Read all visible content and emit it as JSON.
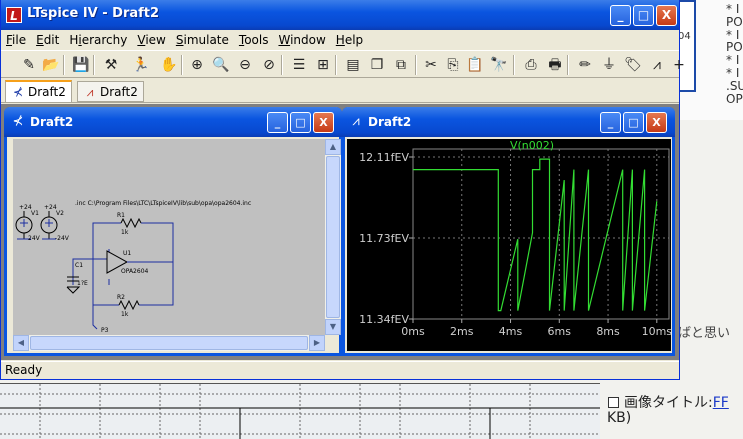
{
  "window": {
    "title": "LTspice IV - Draft2",
    "buttons": {
      "minimize": "_",
      "maximize": "□",
      "close": "X"
    }
  },
  "menu": [
    "File",
    "Edit",
    "Hierarchy",
    "View",
    "Simulate",
    "Tools",
    "Window",
    "Help"
  ],
  "menu_underline": [
    "F",
    "E",
    "i",
    "V",
    "S",
    "T",
    "W",
    "H"
  ],
  "toolbar_icons": [
    "new-schematic-icon",
    "open-icon",
    "save-icon",
    "hammer-icon",
    "run-icon",
    "halt-icon",
    "zoom-in-icon",
    "zoom-area-icon",
    "zoom-out-icon",
    "zoom-cancel-icon",
    "autorange-icon",
    "fit-icon",
    "tile-icon",
    "cascade-icon",
    "arrange-icon",
    "cut-icon",
    "copy-icon",
    "paste-icon",
    "find-icon",
    "print-setup-icon",
    "print-icon",
    "pencil-icon",
    "ground-icon",
    "label-icon",
    "resistor-icon",
    "plus-icon"
  ],
  "tabs": [
    {
      "label": "Draft2",
      "icon": "schematic-icon",
      "active": true
    },
    {
      "label": "Draft2",
      "icon": "waveform-icon",
      "active": false
    }
  ],
  "schematic_window": {
    "title": "Draft2",
    "inc_text": ".inc C:\\Program Files\\LTC\\LTspiceIV\\lib\\sub\\opa\\opa2604.inc",
    "labels": {
      "v1": "V1",
      "v2": "V2",
      "v1_val": "24V",
      "v2_val": "-24V",
      "v1_top": "+24",
      "v2_top": "+24",
      "r1": "R1",
      "r1_val": "1k",
      "r2": "R2",
      "r2_val": "1k",
      "c1": "C1",
      "c1_val": "1?E",
      "u1": "U1",
      "opamp": "OPA2604",
      "p3": "P3"
    }
  },
  "waveform_window": {
    "title": "Draft2",
    "trace_label": "V(n002)",
    "y_ticks": [
      "12.11fEV",
      "11.73fEV",
      "11.34fEV"
    ],
    "x_ticks": [
      "0ms",
      "2ms",
      "4ms",
      "6ms",
      "8ms",
      "10ms"
    ],
    "trace_color": "#33dd33"
  },
  "status": "Ready",
  "background": {
    "code_lines": [
      "* I",
      "PO",
      "* I",
      "PO",
      "* I",
      "* I",
      ".SU",
      "OP"
    ],
    "code_side": "04",
    "jp_note": "ばと思い",
    "checkbox_label": "画像タイトル:",
    "checkbox_link": "FF",
    "kb_text": "KB)"
  },
  "chart_data": {
    "type": "line",
    "title": "",
    "trace_label": "V(n002)",
    "xlabel": "",
    "ylabel": "",
    "xlim": [
      0,
      10.5
    ],
    "ylim": [
      11.34,
      12.11
    ],
    "x_ticks": [
      "0ms",
      "2ms",
      "4ms",
      "6ms",
      "8ms",
      "10ms"
    ],
    "y_ticks": [
      "12.11fEV",
      "11.73fEV",
      "11.34fEV"
    ],
    "grid": true,
    "series": [
      {
        "name": "V(n002)",
        "x": [
          0,
          3.5,
          3.5,
          3.6,
          4.3,
          4.3,
          4.9,
          4.9,
          5.2,
          5.2,
          5.6,
          5.6,
          6.2,
          6.2,
          6.6,
          6.6,
          7.2,
          7.2,
          8.6,
          8.6,
          9.0,
          9.0,
          9.5,
          9.5,
          10.0
        ],
        "y": [
          12.05,
          12.05,
          11.38,
          11.38,
          11.72,
          11.38,
          11.75,
          12.05,
          12.05,
          12.1,
          12.1,
          11.38,
          12.0,
          11.38,
          12.05,
          11.38,
          12.05,
          11.38,
          12.05,
          11.38,
          12.05,
          11.38,
          12.05,
          11.38,
          11.9
        ]
      }
    ]
  }
}
